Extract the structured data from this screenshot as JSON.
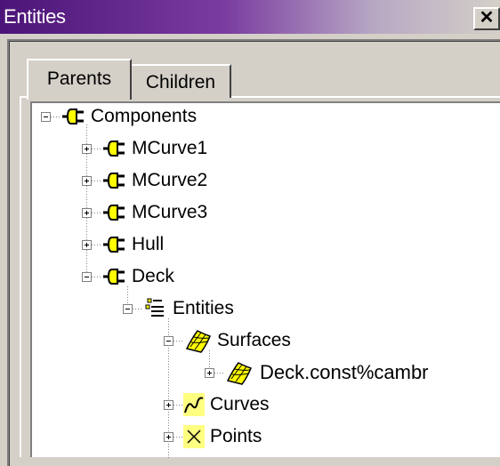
{
  "window": {
    "title": "Entities",
    "close_glyph": "✕"
  },
  "tabs": [
    {
      "label": "Parents",
      "active": true
    },
    {
      "label": "Children",
      "active": false
    }
  ],
  "tree": {
    "nodes": [
      {
        "label": "Components",
        "icon": "component-plug-icon",
        "expander": "minus"
      },
      {
        "label": "MCurve1",
        "icon": "component-plug-icon",
        "expander": "plus"
      },
      {
        "label": "MCurve2",
        "icon": "component-plug-icon",
        "expander": "plus"
      },
      {
        "label": "MCurve3",
        "icon": "component-plug-icon",
        "expander": "plus"
      },
      {
        "label": "Hull",
        "icon": "component-plug-icon",
        "expander": "plus"
      },
      {
        "label": "Deck",
        "icon": "component-plug-icon",
        "expander": "minus"
      },
      {
        "label": "Entities",
        "icon": "entity-list-icon",
        "expander": "minus"
      },
      {
        "label": "Surfaces",
        "icon": "surface-icon",
        "expander": "minus"
      },
      {
        "label": "Deck.const%cambr",
        "icon": "surface-icon",
        "expander": "plus"
      },
      {
        "label": "Curves",
        "icon": "curve-icon",
        "expander": "plus"
      },
      {
        "label": "Points",
        "icon": "points-x-icon",
        "expander": "plus"
      }
    ]
  },
  "colors": {
    "title_gradient_start": "#4c1478",
    "icon_yellow": "#ffff00",
    "icon_highlight": "#ffff80",
    "window_face": "#d4d0c8"
  }
}
